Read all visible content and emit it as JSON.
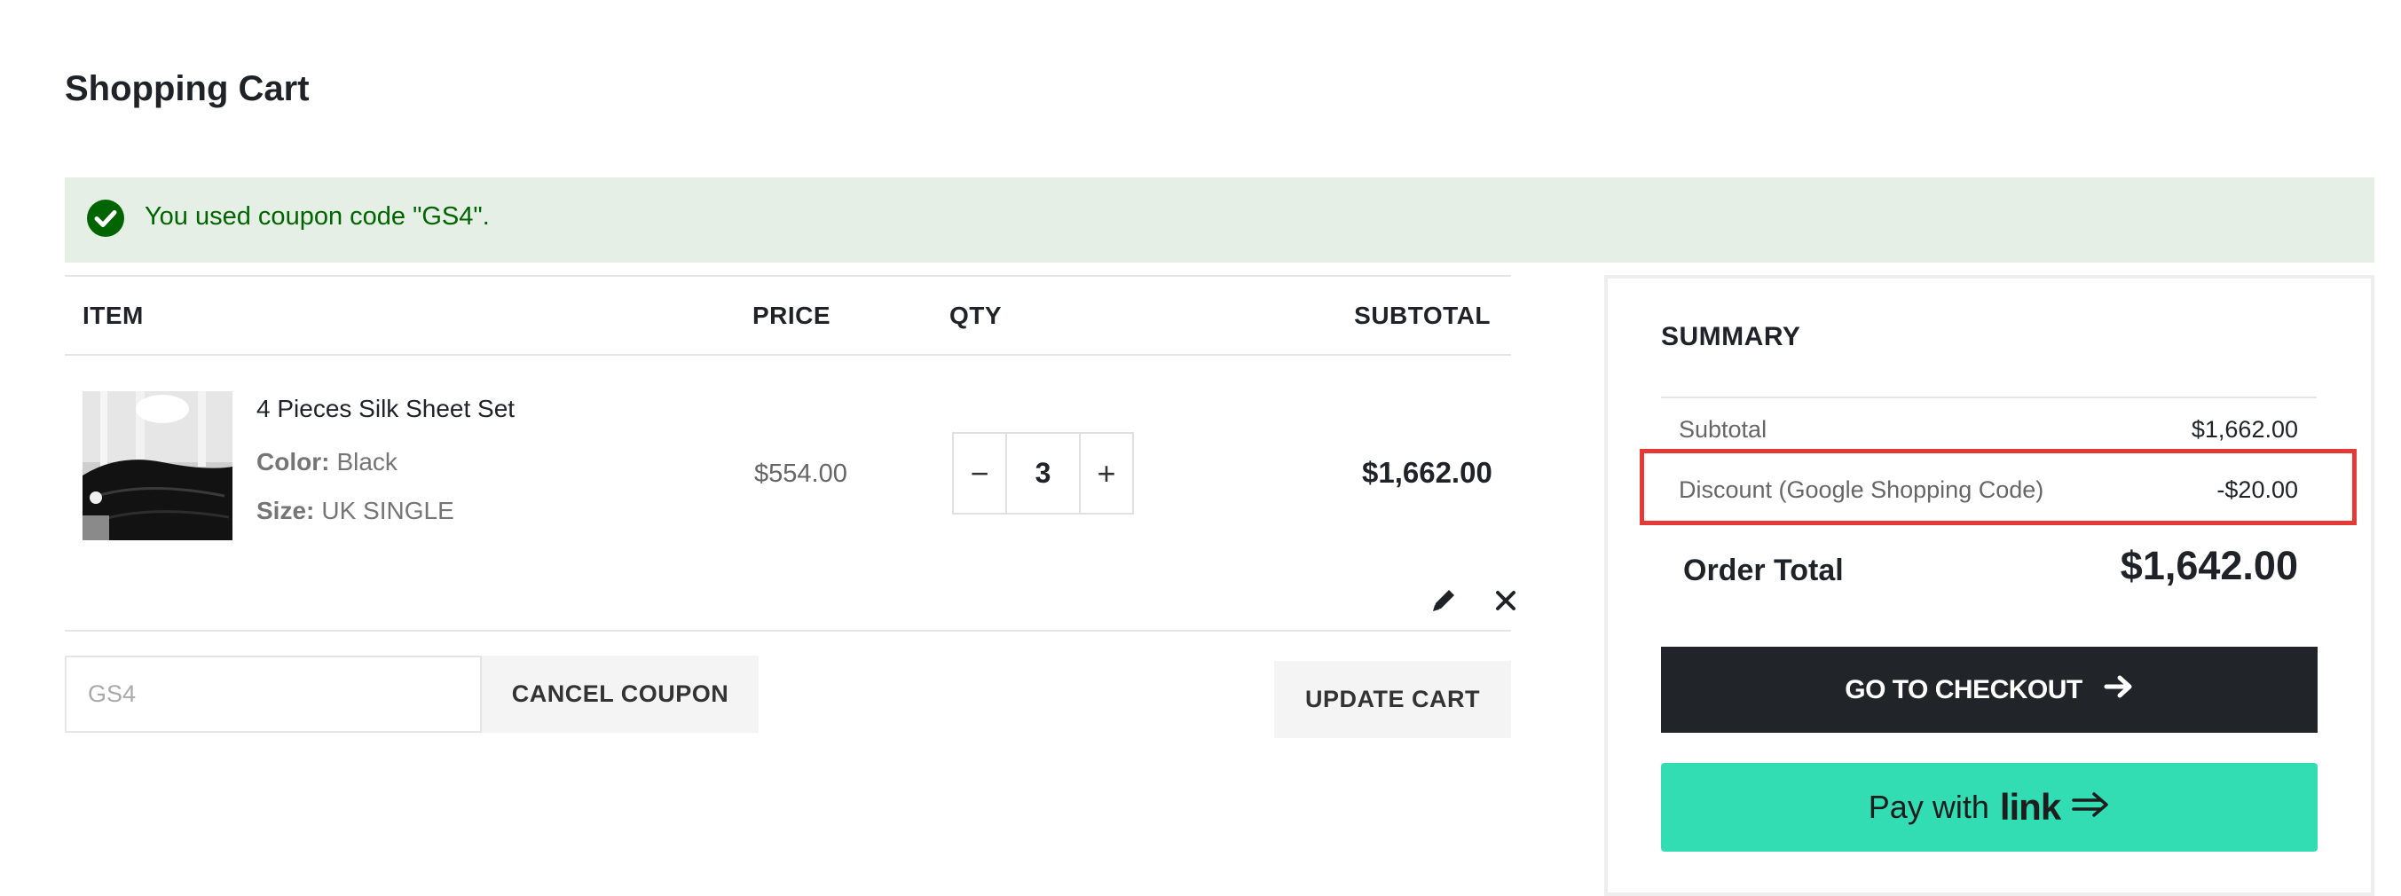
{
  "page": {
    "title": "Shopping Cart"
  },
  "message": {
    "text": "You used coupon code \"GS4\"."
  },
  "cart": {
    "headers": {
      "item": "ITEM",
      "price": "PRICE",
      "qty": "QTY",
      "subtotal": "SUBTOTAL"
    },
    "items": [
      {
        "name": "4 Pieces Silk Sheet Set",
        "color_label": "Color:",
        "color_value": "Black",
        "size_label": "Size:",
        "size_value": "UK SINGLE",
        "price": "$554.00",
        "qty": "3",
        "subtotal": "$1,662.00"
      }
    ],
    "qty_minus": "−",
    "qty_plus": "+"
  },
  "coupon": {
    "value": "GS4",
    "cancel_label": "CANCEL COUPON",
    "update_label": "UPDATE CART"
  },
  "summary": {
    "title": "SUMMARY",
    "subtotal_label": "Subtotal",
    "subtotal_value": "$1,662.00",
    "discount_label": "Discount (Google Shopping Code)",
    "discount_value": "-$20.00",
    "total_label": "Order Total",
    "total_value": "$1,642.00",
    "checkout_label": "GO TO CHECKOUT",
    "paylink_prefix": "Pay with",
    "paylink_brand": "link"
  },
  "colors": {
    "success_bg": "#e5efe5",
    "success_text": "#006400",
    "checkout_bg": "#212429",
    "link_green": "#33ddb3",
    "highlight_red": "#e53935"
  },
  "icons": {
    "success": "check-circle-icon",
    "edit": "pencil-icon",
    "remove": "close-icon",
    "checkout_arrow": "arrow-right-icon",
    "paylink_arrow": "double-arrow-icon"
  }
}
